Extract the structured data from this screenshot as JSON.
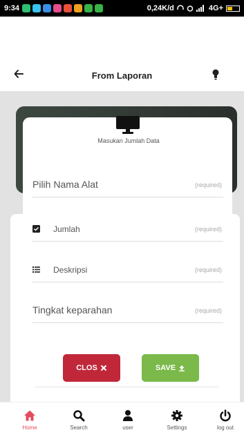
{
  "status_bar": {
    "time": "9:34",
    "network_speed": "0,24K/d",
    "network_type": "4G+",
    "app_icon_colors": [
      "#2fbf71",
      "#36c5f0",
      "#3b8fe6",
      "#e84c8b",
      "#e8503a",
      "#f0a020",
      "#38b348",
      "#38b348"
    ]
  },
  "header": {
    "title": "From Laporan",
    "back_icon": "arrow-left-icon",
    "right_icon": "lightbulb-icon"
  },
  "form": {
    "header_icon": "monitor-icon",
    "subtitle": "Masukan Jumlah Data",
    "fields": [
      {
        "label": "Pilih Nama Alat",
        "hint": "(required)",
        "icon": ""
      },
      {
        "label": "Jumlah",
        "hint": "(required)",
        "icon": "checkbox-icon"
      },
      {
        "label": "Deskripsi",
        "hint": "(required)",
        "icon": "list-icon"
      },
      {
        "label": "Tingkat keparahan",
        "hint": "(required)",
        "icon": ""
      }
    ],
    "close_label": "CLOS",
    "save_label": "SAVE",
    "close_color": "#c0283a",
    "save_color": "#7ab94a"
  },
  "bottom_nav": {
    "active_color": "#e44b5e",
    "items": [
      {
        "label": "Home",
        "icon": "home-icon",
        "active": true
      },
      {
        "label": "Search",
        "icon": "search-icon",
        "active": false
      },
      {
        "label": "user",
        "icon": "user-icon",
        "active": false
      },
      {
        "label": "Settings",
        "icon": "gear-icon",
        "active": false
      },
      {
        "label": "log out",
        "icon": "power-icon",
        "active": false
      }
    ]
  }
}
